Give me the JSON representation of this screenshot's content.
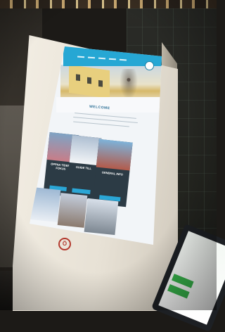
{
  "kiosk": {
    "brand_color": "#b33a2e",
    "logo_icon": "shield-icon"
  },
  "screen": {
    "accent_color": "#26a7d4",
    "welcome_heading": "WELCOME",
    "cards": [
      {
        "title": "ÖPPNA TIDER I FOKUS"
      },
      {
        "title": "GUIDE TILL"
      },
      {
        "title": "GENERAL INFO"
      }
    ],
    "card_button_color": "#2aa6d6"
  },
  "tablet": {
    "button_color": "#37b24a"
  }
}
